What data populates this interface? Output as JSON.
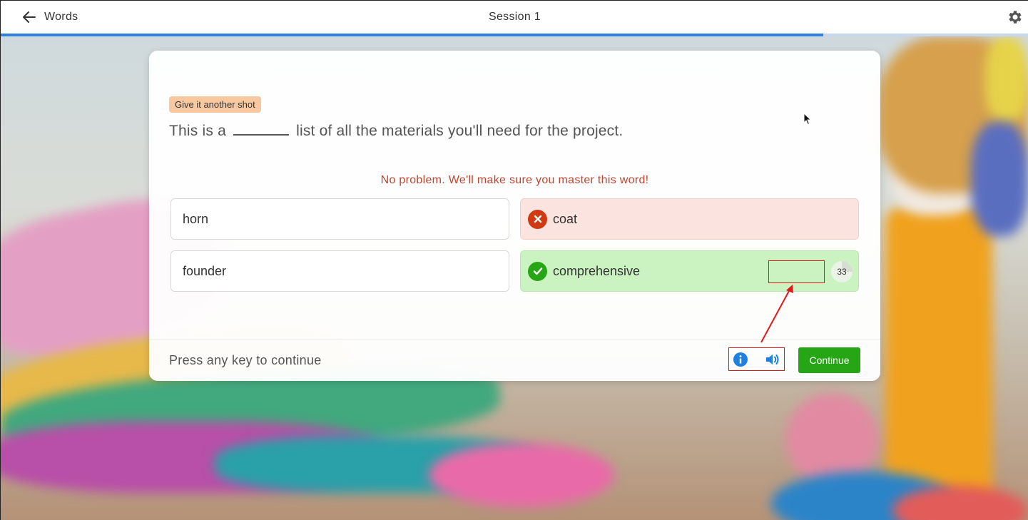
{
  "header": {
    "back_label": "Words",
    "title": "Session 1",
    "progress_fraction": 0.8
  },
  "card": {
    "badge": "Give it another shot",
    "question_before": "This is a",
    "question_after": "list of all the materials you'll need for the project.",
    "feedback": "No problem. We'll make sure you master this word!",
    "options": [
      {
        "label": "horn",
        "state": "neutral"
      },
      {
        "label": "coat",
        "state": "wrong"
      },
      {
        "label": "founder",
        "state": "neutral"
      },
      {
        "label": "comprehensive",
        "state": "correct",
        "count": "33"
      }
    ],
    "footer_hint": "Press any key to continue",
    "continue_label": "Continue"
  },
  "colors": {
    "accent_blue": "#2f7fe0",
    "correct_green": "#27a615",
    "wrong_red": "#d03a13",
    "feedback_red": "#c0452e",
    "annotation_red": "#e01a1a"
  },
  "icons": [
    "back-arrow-icon",
    "gear-icon",
    "close-x-icon",
    "checkmark-icon",
    "info-icon",
    "speaker-icon"
  ]
}
